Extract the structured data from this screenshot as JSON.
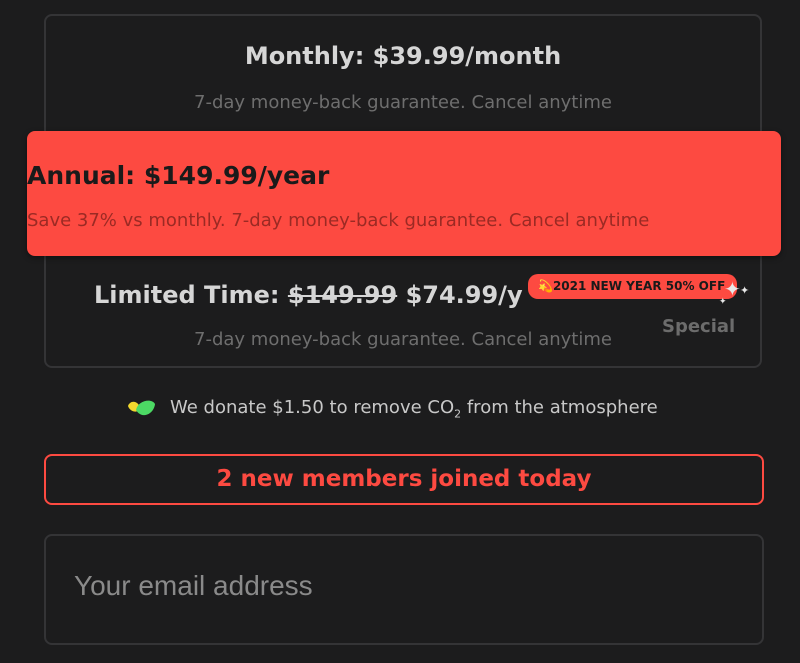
{
  "plans": {
    "monthly": {
      "title": "Monthly: $39.99/month",
      "subtitle": "7-day money-back guarantee. Cancel anytime"
    },
    "annual": {
      "title": "Annual: $149.99/year",
      "subtitle": "Save 37% vs monthly. 7-day money-back guarantee. Cancel anytime"
    },
    "limited": {
      "title_prefix": "Limited Time:",
      "old_price": "$149.99",
      "new_price": "$74.99/y",
      "subtitle": "7-day money-back guarantee. Cancel anytime",
      "badge": "💫2021 NEW YEAR 50% OFF",
      "special_label": "Special"
    }
  },
  "donation": {
    "icon": "leaf-icon",
    "text_before": "We donate $1.50 to remove CO",
    "subscript": "2",
    "text_after": " from the atmosphere"
  },
  "social_proof": {
    "text": "2 new members joined today"
  },
  "email": {
    "placeholder": "Your email address",
    "value": ""
  },
  "colors": {
    "background": "#1c1c1d",
    "accent": "#fd4a41",
    "border": "#343436",
    "text": "#d6d6d6",
    "muted": "#6e6e6e"
  }
}
